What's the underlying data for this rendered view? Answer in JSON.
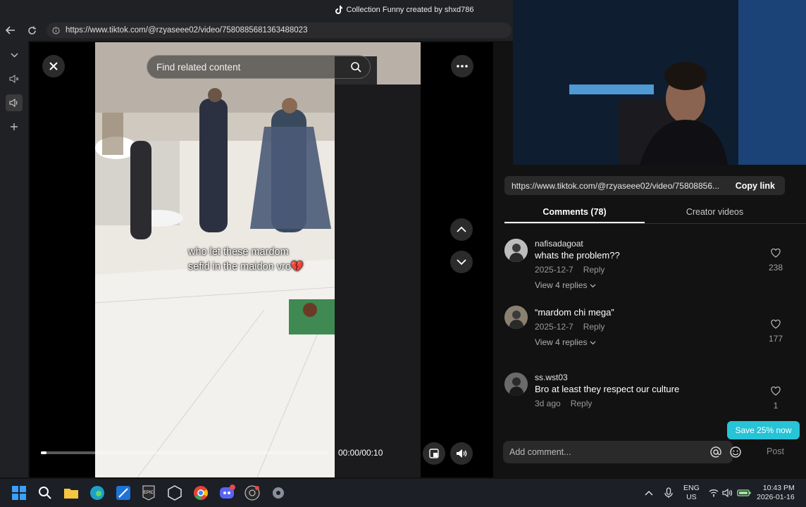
{
  "window": {
    "title": "Collection Funny created by shxd786"
  },
  "browser": {
    "url": "https://www.tiktok.com/@rzyaseee02/video/7580885681363488023"
  },
  "video": {
    "search_placeholder": "Find related content",
    "caption_line1": "who let these mardom",
    "caption_line2": "sefid in the maidon vro",
    "caption_emoji": "💔",
    "time": "00:00/00:10",
    "progress_percent": 2
  },
  "right": {
    "share_link": "https://www.tiktok.com/@rzyaseee02/video/75808856...",
    "copy_label": "Copy link",
    "tabs": [
      {
        "label": "Comments (78)",
        "active": true
      },
      {
        "label": "Creator videos",
        "active": false
      }
    ],
    "comments": [
      {
        "user": "nafisadagoat",
        "text": "whats the problem??",
        "date": "2025-12-7",
        "reply": "Reply",
        "replies": "View 4 replies",
        "likes": "238"
      },
      {
        "user": "",
        "text": "“mardom chi mega”",
        "date": "2025-12-7",
        "reply": "Reply",
        "replies": "View 4 replies",
        "likes": "177"
      },
      {
        "user": "ss.wst03",
        "text": "Bro at least they respect our culture",
        "date": "3d ago",
        "reply": "Reply",
        "replies": "",
        "likes": "1"
      }
    ],
    "save_badge": "Save 25% now",
    "composer_placeholder": "Add comment...",
    "post_label": "Post"
  },
  "taskbar": {
    "lang1": "ENG",
    "lang2": "US",
    "time": "10:43 PM",
    "date": "2026-01-16"
  },
  "colors": {
    "accent": "#27c3d6",
    "bg": "#121212"
  }
}
